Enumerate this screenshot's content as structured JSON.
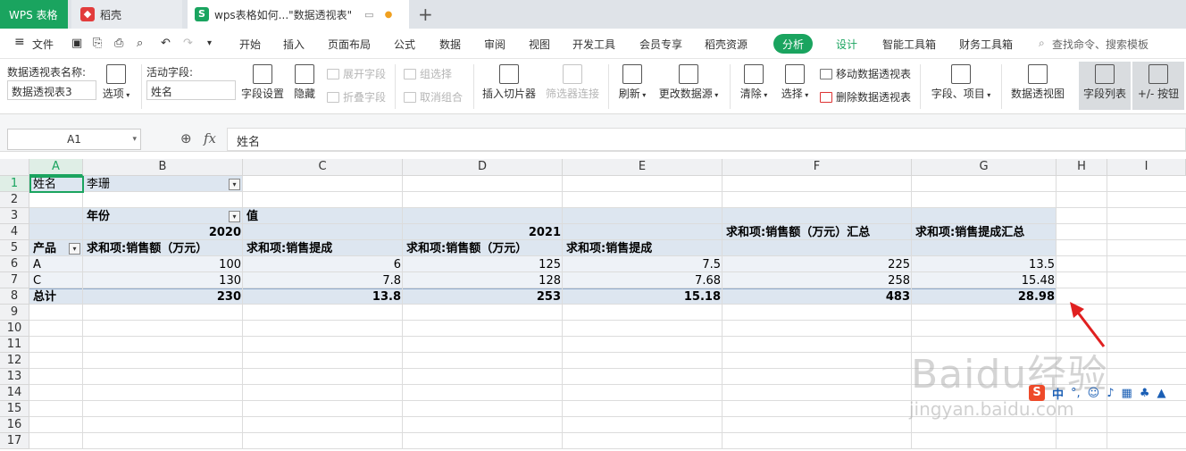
{
  "tabs": {
    "wps": "WPS 表格",
    "daoke": "稻壳",
    "doc": "wps表格如何...\"数据透视表\""
  },
  "menu": {
    "file": "文件",
    "items": [
      "开始",
      "插入",
      "页面布局",
      "公式",
      "数据",
      "审阅",
      "视图",
      "开发工具",
      "会员专享",
      "稻壳资源"
    ],
    "analyze": "分析",
    "design": "设计",
    "extra": [
      "智能工具箱",
      "财务工具箱"
    ],
    "search": "查找命令、搜索模板"
  },
  "ribbon": {
    "pt_name_label": "数据透视表名称:",
    "pt_name_value": "数据透视表3",
    "options": "选项",
    "active_field_label": "活动字段:",
    "active_field_value": "姓名",
    "field_settings": "字段设置",
    "hide": "隐藏",
    "expand": "展开字段",
    "collapse": "折叠字段",
    "group_select": "组选择",
    "ungroup": "取消组合",
    "insert_slicer": "插入切片器",
    "filter_conn": "筛选器连接",
    "refresh": "刷新",
    "change_source": "更改数据源",
    "clear": "清除",
    "select": "选择",
    "move_pt": "移动数据透视表",
    "delete_pt": "删除数据透视表",
    "fields_items": "字段、项目",
    "pivot_view": "数据透视图",
    "field_list": "字段列表",
    "pm_buttons": "+/- 按钮"
  },
  "formula": {
    "cellref": "A1",
    "fx": "fx",
    "content": "姓名"
  },
  "columns": [
    "A",
    "B",
    "C",
    "D",
    "E",
    "F",
    "G",
    "H",
    "I"
  ],
  "rows": [
    "1",
    "2",
    "3",
    "4",
    "5",
    "6",
    "7",
    "8",
    "9",
    "10",
    "11",
    "12",
    "13",
    "14",
    "15",
    "16",
    "17"
  ],
  "pivot": {
    "r1": {
      "a": "姓名",
      "b": "李珊"
    },
    "r3": {
      "b": "年份",
      "c": "值"
    },
    "r4": {
      "y2020": "2020",
      "y2021": "2021",
      "f": "求和项:销售额（万元）汇总",
      "g": "求和项:销售提成汇总"
    },
    "r5": {
      "a": "产品",
      "b": "求和项:销售额（万元）",
      "c": "求和项:销售提成",
      "d": "求和项:销售额（万元）",
      "e": "求和项:销售提成"
    },
    "r6": {
      "a": "A",
      "b": "100",
      "c": "6",
      "d": "125",
      "e": "7.5",
      "f": "225",
      "g": "13.5"
    },
    "r7": {
      "a": "C",
      "b": "130",
      "c": "7.8",
      "d": "128",
      "e": "7.68",
      "f": "258",
      "g": "15.48"
    },
    "r8": {
      "a": "总计",
      "b": "230",
      "c": "13.8",
      "d": "253",
      "e": "15.18",
      "f": "483",
      "g": "28.98"
    }
  },
  "watermark": {
    "main": "Baidu经验",
    "sub": "jingyan.baidu.com"
  },
  "ime": {
    "label": "中"
  },
  "colors": {
    "accent": "#1aa45f",
    "band": "#dde6f0",
    "arrow": "#e02020"
  }
}
